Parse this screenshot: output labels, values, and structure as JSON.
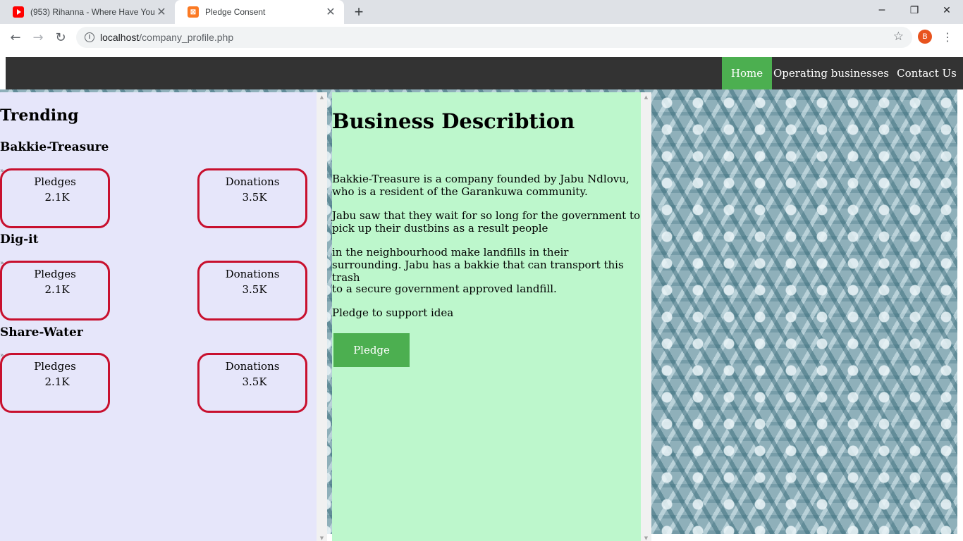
{
  "browser": {
    "tabs": [
      {
        "title": "(953) Rihanna - Where Have You",
        "icon": "youtube-icon",
        "active": false
      },
      {
        "title": "Pledge Consent",
        "icon": "xampp-icon",
        "active": true
      }
    ],
    "url_host": "localhost",
    "url_path": "/company_profile.php",
    "profile_initial": "B"
  },
  "nav": {
    "items": [
      {
        "label": "Home",
        "active": true
      },
      {
        "label": "Operating businesses",
        "active": false
      },
      {
        "label": "Contact Us",
        "active": false
      }
    ]
  },
  "trending": {
    "title": "Trending",
    "businesses": [
      {
        "name": "Bakkie-Treasure",
        "pledges_label": "Pledges",
        "pledges_value": "2.1K",
        "donations_label": "Donations",
        "donations_value": "3.5K"
      },
      {
        "name": "Dig-it",
        "pledges_label": "Pledges",
        "pledges_value": "2.1K",
        "donations_label": "Donations",
        "donations_value": "3.5K"
      },
      {
        "name": "Share-Water",
        "pledges_label": "Pledges",
        "pledges_value": "2.1K",
        "donations_label": "Donations",
        "donations_value": "3.5K"
      }
    ]
  },
  "description": {
    "title": "Business Describtion",
    "paragraphs": [
      "Bakkie-Treasure is a company founded by Jabu Ndlovu, who is a resident of the Garankuwa community.",
      "Jabu saw that they wait for so long for the government to pick up their dustbins as a result people",
      "in the neighbourhood make landfills in their surrounding. Jabu has a bakkie that can transport this trash",
      "to a secure government approved landfill.",
      "Pledge to support idea"
    ],
    "button_label": "Pledge"
  },
  "colors": {
    "nav_bg": "#333333",
    "active_green": "#4caf50",
    "left_panel_bg": "#e6e6fa",
    "mid_panel_bg": "#bdf7cc",
    "stat_border": "#c8102e"
  }
}
